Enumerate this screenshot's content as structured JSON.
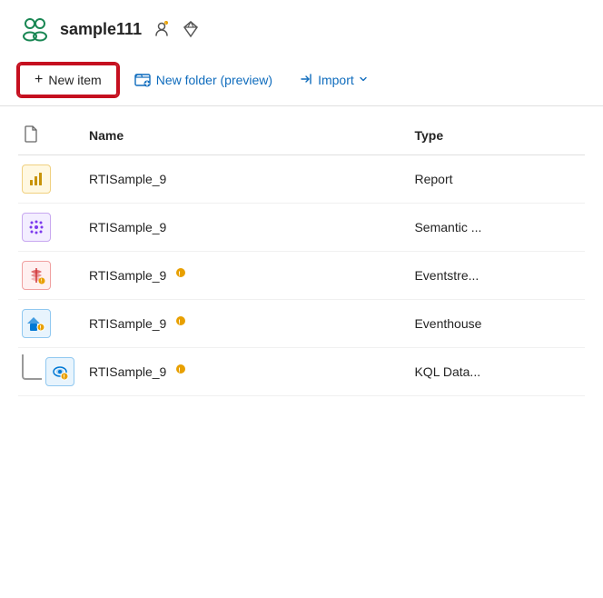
{
  "header": {
    "title": "sample111",
    "icons": [
      "settings-person-icon",
      "diamond-icon"
    ]
  },
  "toolbar": {
    "new_item_label": "New item",
    "new_folder_label": "New folder (preview)",
    "import_label": "Import"
  },
  "table": {
    "columns": [
      {
        "key": "icon",
        "label": ""
      },
      {
        "key": "name",
        "label": "Name"
      },
      {
        "key": "type",
        "label": "Type"
      }
    ],
    "rows": [
      {
        "id": 1,
        "name": "RTISample_9",
        "type": "Report",
        "icon_type": "report",
        "has_warning": false,
        "indent": false
      },
      {
        "id": 2,
        "name": "RTISample_9",
        "type": "Semantic ...",
        "icon_type": "semantic",
        "has_warning": false,
        "indent": false
      },
      {
        "id": 3,
        "name": "RTISample_9",
        "type": "Eventstre...",
        "icon_type": "eventstream",
        "has_warning": true,
        "indent": false
      },
      {
        "id": 4,
        "name": "RTISample_9",
        "type": "Eventhouse",
        "icon_type": "eventhouse",
        "has_warning": true,
        "indent": false
      },
      {
        "id": 5,
        "name": "RTISample_9",
        "type": "KQL Data...",
        "icon_type": "kql",
        "has_warning": true,
        "indent": true
      }
    ]
  }
}
